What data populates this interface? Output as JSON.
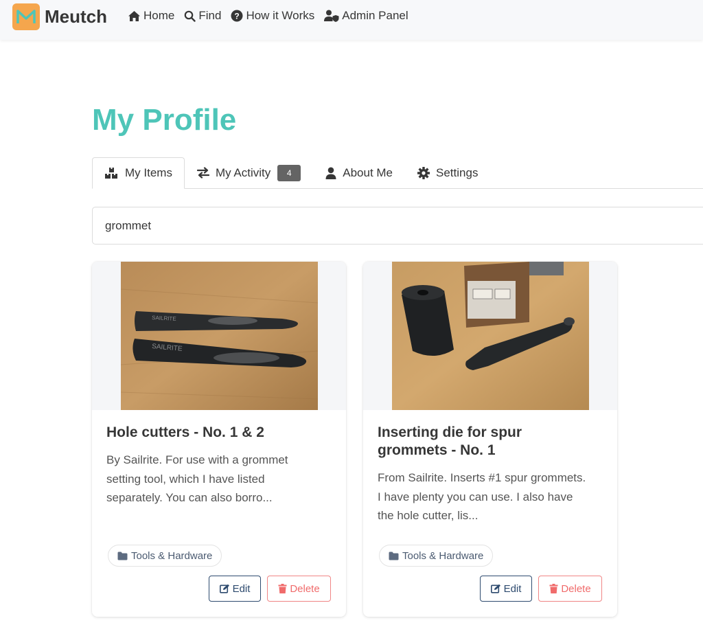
{
  "app": {
    "brand": "Meutch"
  },
  "nav": [
    {
      "label": "Home",
      "icon": "home-icon"
    },
    {
      "label": "Find",
      "icon": "search-icon"
    },
    {
      "label": "How it Works",
      "icon": "question-circle-icon"
    },
    {
      "label": "Admin Panel",
      "icon": "user-shield-icon"
    }
  ],
  "page": {
    "title": "My Profile"
  },
  "tabs": [
    {
      "label": "My Items",
      "icon": "items-icon",
      "active": true
    },
    {
      "label": "My Activity",
      "icon": "exchange-icon",
      "badge": "4"
    },
    {
      "label": "About Me",
      "icon": "user-icon"
    },
    {
      "label": "Settings",
      "icon": "gear-icon"
    }
  ],
  "search": {
    "value": "grommet"
  },
  "cards": [
    {
      "title": "Hole cutters - No. 1 & 2",
      "description_lines": [
        "By Sailrite. For use with a grommet",
        "setting tool, which I have listed",
        "separately. You can also borro..."
      ],
      "tag": "Tools & Hardware",
      "edit_label": "Edit",
      "delete_label": "Delete"
    },
    {
      "title_lines": [
        "Inserting die for spur",
        "grommets - No. 1"
      ],
      "description_lines": [
        "From Sailrite. Inserts #1 spur grommets.",
        "I have plenty you can use. I also have",
        "the hole cutter, lis..."
      ],
      "tag": "Tools & Hardware",
      "edit_label": "Edit",
      "delete_label": "Delete"
    }
  ],
  "colors": {
    "accent": "#4ec5b8",
    "logo": "#f5a64d",
    "edit": "#2d4a6e",
    "delete": "#f06b6b"
  }
}
